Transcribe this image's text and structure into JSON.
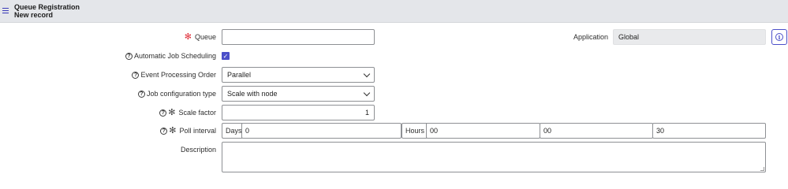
{
  "header": {
    "title": "Queue Registration",
    "subtitle": "New record"
  },
  "form": {
    "queue": {
      "label": "Queue",
      "value": ""
    },
    "application": {
      "label": "Application",
      "value": "Global"
    },
    "auto_job": {
      "label": "Automatic Job Scheduling",
      "checked": true
    },
    "event_order": {
      "label": "Event Processing Order",
      "value": "Parallel"
    },
    "job_config": {
      "label": "Job configuration type",
      "value": "Scale with node"
    },
    "scale_factor": {
      "label": "Scale factor",
      "value": "1"
    },
    "poll_interval": {
      "label": "Poll interval",
      "days_label": "Days",
      "days": "0",
      "hours_label": "Hours",
      "hours": "00",
      "minutes": "00",
      "seconds": "30"
    },
    "description": {
      "label": "Description",
      "value": ""
    }
  },
  "icons": {
    "menu": "hamburger-menu-icon",
    "help": "question-circle-icon",
    "required": "asterisk-icon",
    "info": "info-circle-icon",
    "dropdown": "chevron-down-icon",
    "check": "checkmark-icon"
  },
  "colors": {
    "accent": "#4b4fc9",
    "required": "#e0303a",
    "header_bg": "#e4e6ea"
  }
}
